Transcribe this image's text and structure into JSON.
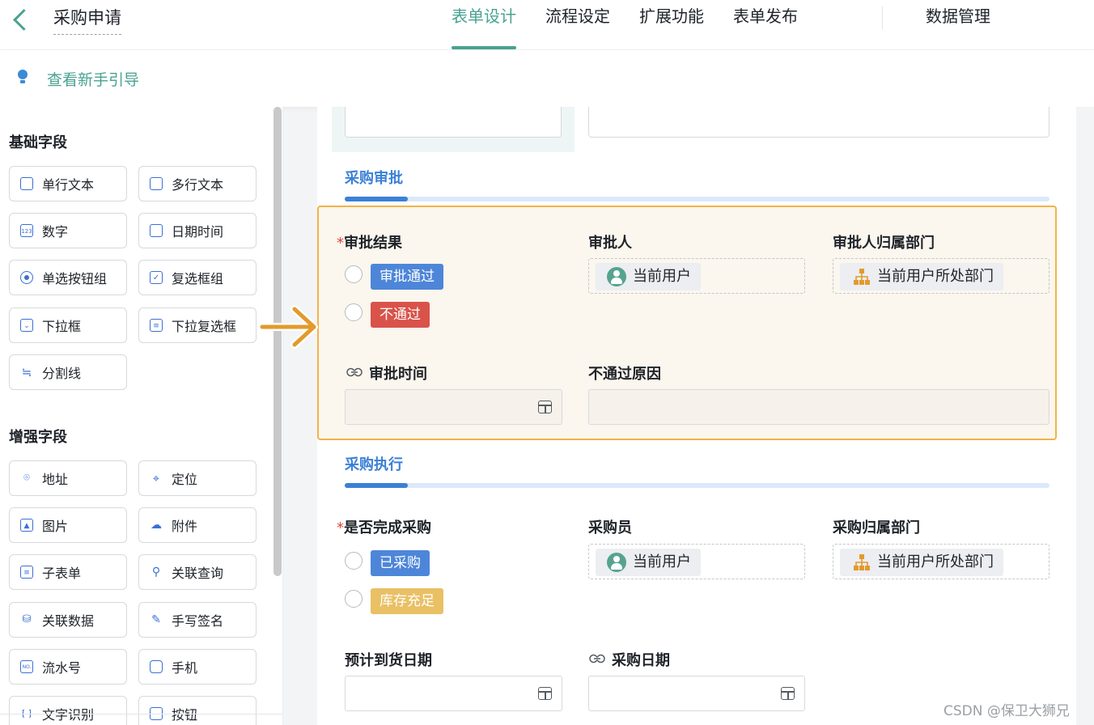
{
  "header": {
    "app_title": "采购申请",
    "tabs": [
      {
        "label": "表单设计",
        "active": true
      },
      {
        "label": "流程设定",
        "active": false
      },
      {
        "label": "扩展功能",
        "active": false
      },
      {
        "label": "表单发布",
        "active": false
      }
    ],
    "data_tab": "数据管理"
  },
  "guide": {
    "text": "查看新手引导"
  },
  "left_panel": {
    "basic_title": "基础字段",
    "basic_fields": [
      "单行文本",
      "多行文本",
      "数字",
      "日期时间",
      "单选按钮组",
      "复选框组",
      "下拉框",
      "下拉复选框",
      "分割线"
    ],
    "enhanced_title": "增强字段",
    "enhanced_fields": [
      "地址",
      "定位",
      "图片",
      "附件",
      "子表单",
      "关联查询",
      "关联数据",
      "手写签名",
      "流水号",
      "手机",
      "文字识别",
      "按钮"
    ]
  },
  "form": {
    "approval": {
      "title": "采购审批",
      "result_label": "审批结果",
      "result_options": [
        "审批通过",
        "不通过"
      ],
      "approver_label": "审批人",
      "approver_value": "当前用户",
      "dept_label": "审批人归属部门",
      "dept_value": "当前用户所处部门",
      "time_label": "审批时间",
      "reason_label": "不通过原因"
    },
    "execution": {
      "title": "采购执行",
      "done_label": "是否完成采购",
      "done_options": [
        "已采购",
        "库存充足"
      ],
      "buyer_label": "采购员",
      "buyer_value": "当前用户",
      "dept_label": "采购归属部门",
      "dept_value": "当前用户所处部门",
      "eta_label": "预计到货日期",
      "date_label": "采购日期"
    }
  },
  "watermark": "CSDN @保卫大狮兄",
  "colors": {
    "accent": "#48a292",
    "highlight_border": "#f2b347",
    "section_blue": "#3b80d6",
    "arrow": "#e39a2c"
  }
}
